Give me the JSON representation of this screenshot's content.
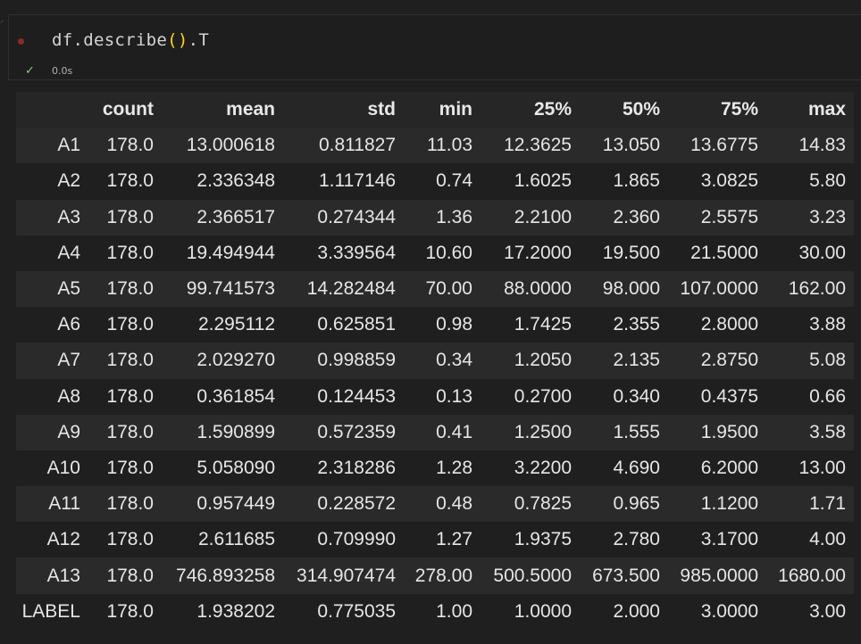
{
  "cell": {
    "code_prefix": "df.describe",
    "code_paren_open": "(",
    "code_paren_close": ")",
    "code_suffix": ".T",
    "status_icon": "check-icon",
    "exec_time": "0.0s"
  },
  "table": {
    "columns": [
      "",
      "count",
      "mean",
      "std",
      "min",
      "25%",
      "50%",
      "75%",
      "max"
    ],
    "rows": [
      [
        "A1",
        "178.0",
        "13.000618",
        "0.811827",
        "11.03",
        "12.3625",
        "13.050",
        "13.6775",
        "14.83"
      ],
      [
        "A2",
        "178.0",
        "2.336348",
        "1.117146",
        "0.74",
        "1.6025",
        "1.865",
        "3.0825",
        "5.80"
      ],
      [
        "A3",
        "178.0",
        "2.366517",
        "0.274344",
        "1.36",
        "2.2100",
        "2.360",
        "2.5575",
        "3.23"
      ],
      [
        "A4",
        "178.0",
        "19.494944",
        "3.339564",
        "10.60",
        "17.2000",
        "19.500",
        "21.5000",
        "30.00"
      ],
      [
        "A5",
        "178.0",
        "99.741573",
        "14.282484",
        "70.00",
        "88.0000",
        "98.000",
        "107.0000",
        "162.00"
      ],
      [
        "A6",
        "178.0",
        "2.295112",
        "0.625851",
        "0.98",
        "1.7425",
        "2.355",
        "2.8000",
        "3.88"
      ],
      [
        "A7",
        "178.0",
        "2.029270",
        "0.998859",
        "0.34",
        "1.2050",
        "2.135",
        "2.8750",
        "5.08"
      ],
      [
        "A8",
        "178.0",
        "0.361854",
        "0.124453",
        "0.13",
        "0.2700",
        "0.340",
        "0.4375",
        "0.66"
      ],
      [
        "A9",
        "178.0",
        "1.590899",
        "0.572359",
        "0.41",
        "1.2500",
        "1.555",
        "1.9500",
        "3.58"
      ],
      [
        "A10",
        "178.0",
        "5.058090",
        "2.318286",
        "1.28",
        "3.2200",
        "4.690",
        "6.2000",
        "13.00"
      ],
      [
        "A11",
        "178.0",
        "0.957449",
        "0.228572",
        "0.48",
        "0.7825",
        "0.965",
        "1.1200",
        "1.71"
      ],
      [
        "A12",
        "178.0",
        "2.611685",
        "0.709990",
        "1.27",
        "1.9375",
        "2.780",
        "3.1700",
        "4.00"
      ],
      [
        "A13",
        "178.0",
        "746.893258",
        "314.907474",
        "278.00",
        "500.5000",
        "673.500",
        "985.0000",
        "1680.00"
      ],
      [
        "LABEL",
        "178.0",
        "1.938202",
        "0.775035",
        "1.00",
        "1.0000",
        "2.000",
        "3.0000",
        "3.00"
      ]
    ]
  }
}
